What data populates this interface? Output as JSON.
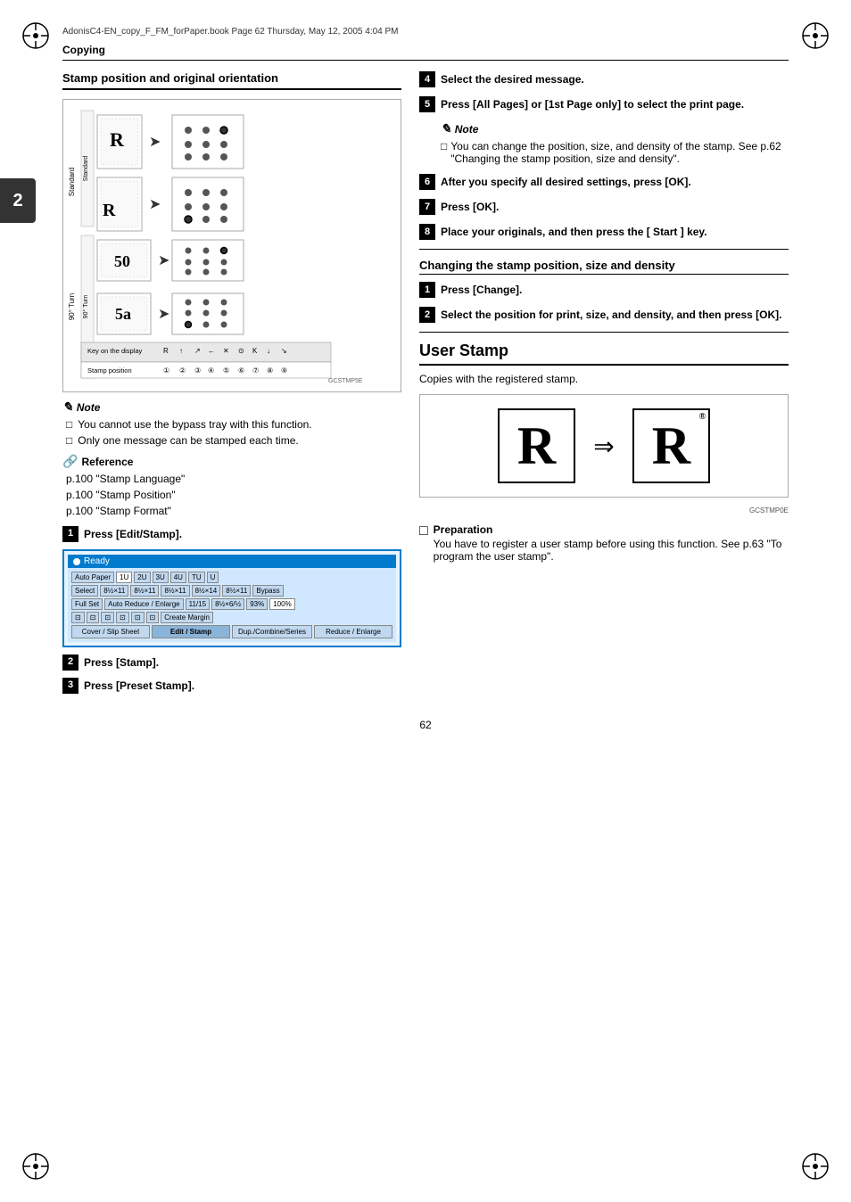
{
  "meta": {
    "filename": "AdonisC4-EN_copy_F_FM_forPaper.book  Page 62  Thursday, May 12, 2005  4:04 PM",
    "section": "Copying",
    "page_number": "62",
    "chapter_num": "2"
  },
  "left_column": {
    "section_heading": "Stamp position and original orientation",
    "diagram_label_gcstmp": "GCSTMP5E",
    "note_title": "Note",
    "note_items": [
      "You cannot use the bypass tray with this function.",
      "Only one message can be stamped each time."
    ],
    "reference_title": "Reference",
    "reference_items": [
      "p.100 \"Stamp Language\"",
      "p.100 \"Stamp Position\"",
      "p.100 \"Stamp Format\""
    ],
    "steps": [
      {
        "num": "1",
        "text": "Press [Edit/Stamp]."
      },
      {
        "num": "2",
        "text": "Press [Stamp]."
      },
      {
        "num": "3",
        "text": "Press [Preset Stamp]."
      }
    ],
    "ui_screenshot": {
      "title": "Ready",
      "row1": [
        "Auto Paper",
        "1U",
        "2U",
        "3U",
        "4U",
        "TU",
        "U"
      ],
      "row1b": [
        "Select",
        "8½×11",
        "8½×11",
        "8½×11",
        "8½×14",
        "8½×11",
        "Bypass"
      ],
      "row2": [
        "Full Set",
        "Auto Reduce / Enlarge",
        "11/15",
        "8½×6/½",
        "93%",
        "100%"
      ],
      "row3_icons": [
        "icon1",
        "icon2",
        "icon3",
        "icon4",
        "icon5",
        "icon6",
        "Create Margin"
      ],
      "bottom_btns": [
        "Cover / Slip Sheet",
        "Edit / Stamp",
        "Dup./Combine/Series",
        "Reduce / Enlarge"
      ]
    },
    "key_table": {
      "headers": [
        "Key on the display",
        "R",
        "↑",
        "↗",
        "←",
        "✕",
        "⊙",
        "K",
        "↓",
        "↘"
      ],
      "row": [
        "Stamp position",
        "①",
        "②",
        "③",
        "④",
        "⑤",
        "⑥",
        "⑦",
        "⑧",
        "⑨"
      ]
    },
    "standard_label": "Standard",
    "turn_label": "90° Turn"
  },
  "right_column": {
    "steps": [
      {
        "num": "4",
        "text": "Select the desired message."
      },
      {
        "num": "5",
        "text": "Press [All Pages] or [1st Page only] to select the print page."
      },
      {
        "num": "6",
        "text": "After you specify all desired settings, press [OK]."
      },
      {
        "num": "7",
        "text": "Press [OK]."
      },
      {
        "num": "8",
        "text": "Place your originals, and then press the [ Start ] key."
      }
    ],
    "note_title": "Note",
    "note_items": [
      "You can change the position, size, and density of the stamp. See p.62 \"Changing the stamp position, size and density\"."
    ],
    "changing_heading": "Changing the stamp position, size and density",
    "changing_steps": [
      {
        "num": "1",
        "text": "Press [Change]."
      },
      {
        "num": "2",
        "text": "Select the position for print, size, and density, and then press [OK]."
      }
    ],
    "user_stamp_heading": "User Stamp",
    "user_stamp_desc": "Copies with the registered stamp.",
    "diagram_gcstmp": "GCSTMP0E",
    "preparation_title": "Preparation",
    "preparation_text": "You have to register a user stamp before using this function. See p.63 \"To program the user stamp\"."
  }
}
